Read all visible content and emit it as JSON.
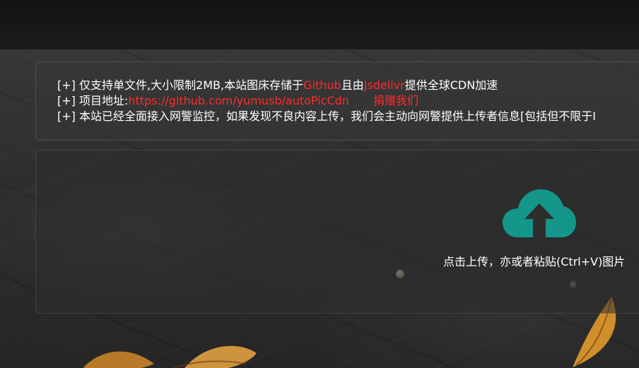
{
  "notice": {
    "prefix_1": "[+] ",
    "line1_a": "仅支持单文件,大小限制2MB,本站图床存储于",
    "line1_github": "Github",
    "line1_b": "且由",
    "line1_jsdelivr": "Jsdelivr",
    "line1_c": "提供全球CDN加速",
    "prefix_2": "[+] ",
    "line2_label": "项目地址:",
    "line2_url": "https://github.com/yumusb/autoPicCdn",
    "line2_donate": "捐赠我们",
    "prefix_3": "[+] ",
    "line3_text": "本站已经全面接入网警监控，如果发现不良内容上传，我们会主动向网警提供上传者信息[包括但不限于I"
  },
  "upload": {
    "icon": "cloud-upload-icon",
    "label": "点击上传，亦或者粘贴(Ctrl+V)图片"
  },
  "colors": {
    "accent_red": "#ff2b2b",
    "cloud_teal": "#14968a",
    "text": "#ffffff"
  }
}
